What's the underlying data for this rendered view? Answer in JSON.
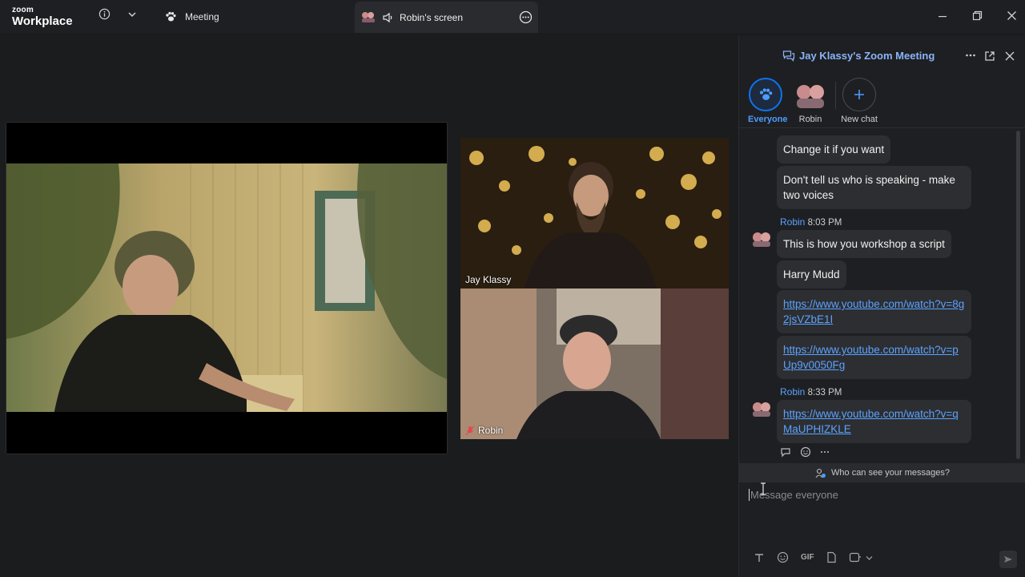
{
  "app": {
    "logo_small": "zoom",
    "logo_big": "Workplace"
  },
  "titlebar": {
    "meeting_tab_label": "Meeting",
    "screen_tab_label": "Robin's screen"
  },
  "video": {
    "participants": [
      {
        "name": "Jay Klassy",
        "muted": false
      },
      {
        "name": "Robin",
        "muted": true
      }
    ]
  },
  "chat": {
    "title": "Jay Klassy's Zoom Meeting",
    "tabs": [
      {
        "label": "Everyone",
        "active": true
      },
      {
        "label": "Robin",
        "active": false
      },
      {
        "label": "New chat",
        "active": false
      }
    ],
    "messages": [
      {
        "text": "Change it if you want"
      },
      {
        "text": "Don't tell us who is speaking - make two voices"
      },
      {
        "sender": "Robin",
        "time": "8:03 PM"
      },
      {
        "text": "This is how you workshop a script"
      },
      {
        "text": "Harry Mudd"
      },
      {
        "link": "https://www.youtube.com/watch?v=8g2jsVZbE1I"
      },
      {
        "link": "https://www.youtube.com/watch?v=pUp9v0050Fg"
      },
      {
        "sender": "Robin",
        "time": "8:33 PM"
      },
      {
        "link": "https://www.youtube.com/watch?v=qMaUPHIZKLE"
      }
    ],
    "visibility_text": "Who can see your messages?",
    "input_placeholder": "Message everyone",
    "toolbar": {
      "gif_label": "GIF"
    }
  },
  "colors": {
    "accent": "#5aa2ff",
    "active_tab": "#0e72ed",
    "muted_red": "#e5484d"
  }
}
